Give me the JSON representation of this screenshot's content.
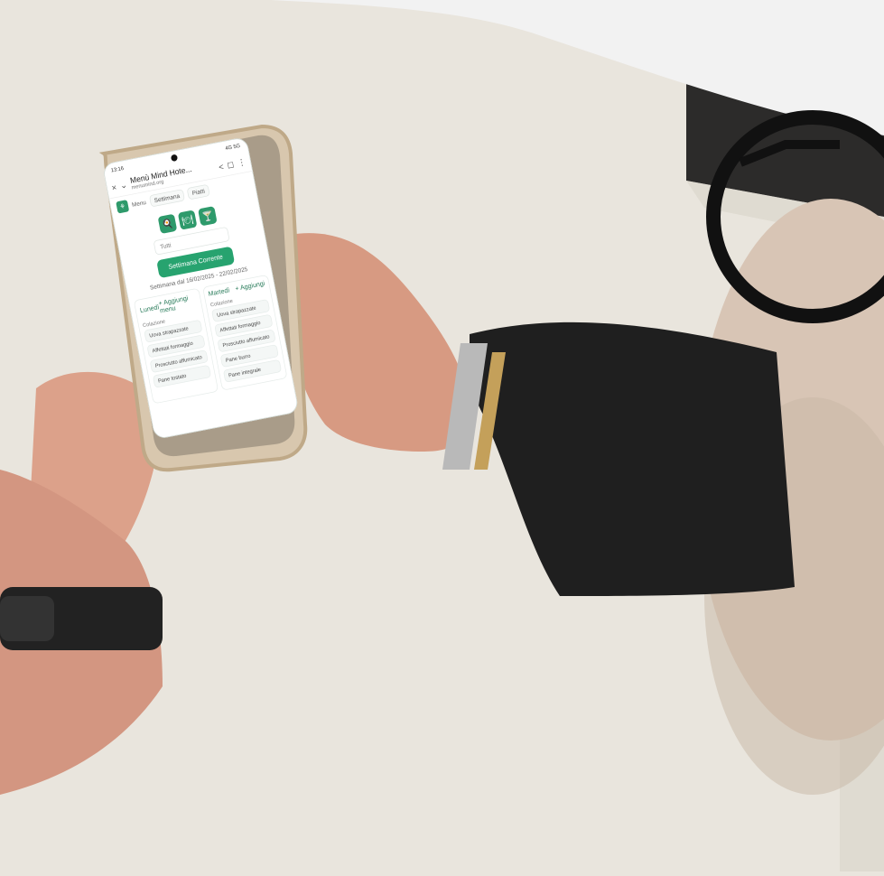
{
  "status_bar": {
    "time": "13:16",
    "network": "4G 5G"
  },
  "browser": {
    "page_title": "Menù Mind Hote...",
    "domain": "menumind.org",
    "close": "×",
    "down": "⌄",
    "share": "<",
    "tabs": "◻",
    "more": "⋮"
  },
  "app": {
    "nav": {
      "menu_label": "Menu",
      "tab_week": "Settimana",
      "tab_dishes": "Piatti"
    },
    "quick_icons": [
      "icon-a",
      "icon-b",
      "icon-c"
    ],
    "filter_select_value": "Tutti",
    "cta_label": "Settimana Corrente",
    "week_range": "Settimana dal 16/02/2025 - 22/02/2025",
    "days": [
      {
        "day_label": "Lunedì",
        "add_label": "+ Aggiungi menu",
        "sections": [
          {
            "title": "Colazione",
            "items": [
              "Uova strapazzate",
              "Affettati formaggio",
              "Prosciutto affumicato",
              "Pane tostato"
            ]
          }
        ]
      },
      {
        "day_label": "Martedì",
        "add_label": "+ Aggiungi",
        "sections": [
          {
            "title": "Colazione",
            "items": [
              "Uova strapazzate",
              "Affettati formaggio",
              "Prosciutto affumicato",
              "Pane burro",
              "Pane integrale"
            ]
          }
        ]
      }
    ]
  },
  "colors": {
    "brand_green": "#27a36f",
    "accent_dark_green": "#2e9a6b",
    "table": "#e9e5dd",
    "shirt": "#1f1f1f",
    "phone_frame": "#c9b69d"
  }
}
